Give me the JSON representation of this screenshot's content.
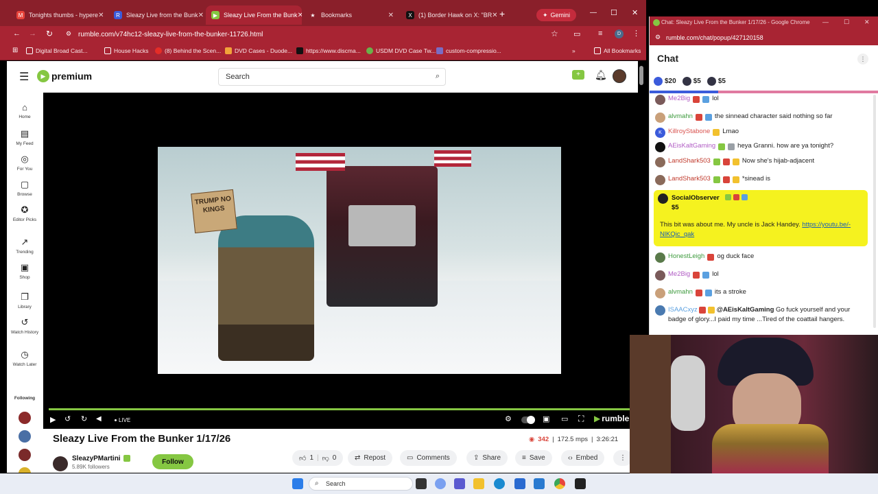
{
  "tabs": [
    {
      "label": "Tonights thumbs - hypere",
      "color": "#e8453c"
    },
    {
      "label": "Sleazy Live from the Bunk",
      "color": "#3b5bdb"
    },
    {
      "label": "Sleazy Live From the Bunk",
      "color": "#85c742"
    },
    {
      "label": "Bookmarks",
      "color": "#ffffff"
    },
    {
      "label": "(1) Border Hawk on X: \"BR",
      "color": "#111111"
    }
  ],
  "gemini_label": "Gemini",
  "address_url": "rumble.com/v74hc12-sleazy-live-from-the-bunker-11726.html",
  "bookmarks": [
    {
      "label": "Digital Broad Cast..."
    },
    {
      "label": "House Hacks"
    },
    {
      "label": "(8) Behind the Scen..."
    },
    {
      "label": "DVD Cases - Duode..."
    },
    {
      "label": "https://www.discma..."
    },
    {
      "label": "USDM DVD Case Tw..."
    },
    {
      "label": "custom-compressio..."
    }
  ],
  "bookmarks_more": "»",
  "all_bookmarks": "All Bookmarks",
  "header": {
    "logo": "premium",
    "search_placeholder": "Search"
  },
  "sidenav": [
    {
      "icon": "⌂",
      "label": "Home"
    },
    {
      "icon": "▤",
      "label": "My Feed"
    },
    {
      "icon": "◎",
      "label": "For You"
    },
    {
      "icon": "▢",
      "label": "Browse"
    },
    {
      "icon": "✪",
      "label": "Editor Picks"
    },
    {
      "icon": "↗",
      "label": "Trending"
    },
    {
      "icon": "▣",
      "label": "Shop"
    },
    {
      "icon": "❐",
      "label": "Library"
    },
    {
      "icon": "↺",
      "label": "Watch History"
    },
    {
      "icon": "◷",
      "label": "Watch Later"
    }
  ],
  "following_label": "Following",
  "video": {
    "sign_text": "TRUMP NO KINGS",
    "live_label": "LIVE",
    "brand": "rumble",
    "progress": 1.0
  },
  "meta": {
    "title": "Sleazy Live From the Bunker 1/17/26",
    "viewers": "342",
    "mps": "172.5 mps",
    "duration": "3:26:21",
    "channel": "SleazyPMartini",
    "followers": "5.89K followers",
    "follow_label": "Follow",
    "likes": "1",
    "dislikes": "0",
    "repost": "Repost",
    "comments": "Comments",
    "share": "Share",
    "save": "Save",
    "embed": "Embed"
  },
  "chat": {
    "window_title": "Chat: Sleazy Live From the Bunker 1/17/26 - Google Chrome",
    "url": "rumble.com/chat/popup/427120158",
    "heading": "Chat",
    "rants": [
      {
        "amount": "$20",
        "color": "#3b5bdb"
      },
      {
        "amount": "$5",
        "color": "#333344"
      },
      {
        "amount": "$5",
        "color": "#333344"
      }
    ],
    "messages": [
      {
        "user": "Me2Big",
        "text": "lol",
        "color": "#b05cc4"
      },
      {
        "user": "alvmahn",
        "text": "the sinnead character said nothing so far",
        "color": "#3d9a3d"
      },
      {
        "user": "KillroyStabone",
        "text": "Lmao",
        "color": "#d9534f"
      },
      {
        "user": "AEisKaltGaming",
        "text": "heya Granni. how are ya tonight?",
        "color": "#b05cc4"
      },
      {
        "user": "LandShark503",
        "text": "Now she's hijab-adjacent",
        "color": "#c0392b"
      },
      {
        "user": "LandShark503",
        "text": "*sinead is",
        "color": "#c0392b"
      }
    ],
    "highlight": {
      "user": "SocialObserver",
      "amount": "$5",
      "text": "This bit was about me. My uncle is Jack Handey.",
      "link": "https://youtu.be/-NlKQic_qak"
    },
    "messages2": [
      {
        "user": "HonestLeigh",
        "text": "og duck face",
        "color": "#3d9a3d"
      },
      {
        "user": "Me2Big",
        "text": "lol",
        "color": "#b05cc4"
      },
      {
        "user": "alvmahn",
        "text": "its a stroke",
        "color": "#3d9a3d"
      }
    ],
    "last": {
      "user": "ISAACxyz",
      "mention": "@AEisKaltGaming",
      "text": "Go fuck yourself and your badge of glory...I paid my time ...Tired of the coattail hangers."
    }
  },
  "taskbar": {
    "search": "Search"
  }
}
